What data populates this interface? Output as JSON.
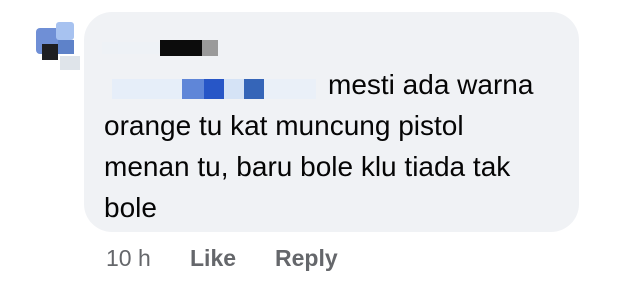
{
  "comment": {
    "text_first_line": "mesti ada warna",
    "text_rest": "orange tu kat muncung pistol\nmenan tu, baru bole klu tiada tak\nbole",
    "timestamp": "10 h",
    "like_label": "Like",
    "reply_label": "Reply"
  },
  "colors": {
    "bubble": "#f0f2f5",
    "text": "#050505",
    "meta": "#65676b",
    "redact_blue": "#2e63c9"
  }
}
